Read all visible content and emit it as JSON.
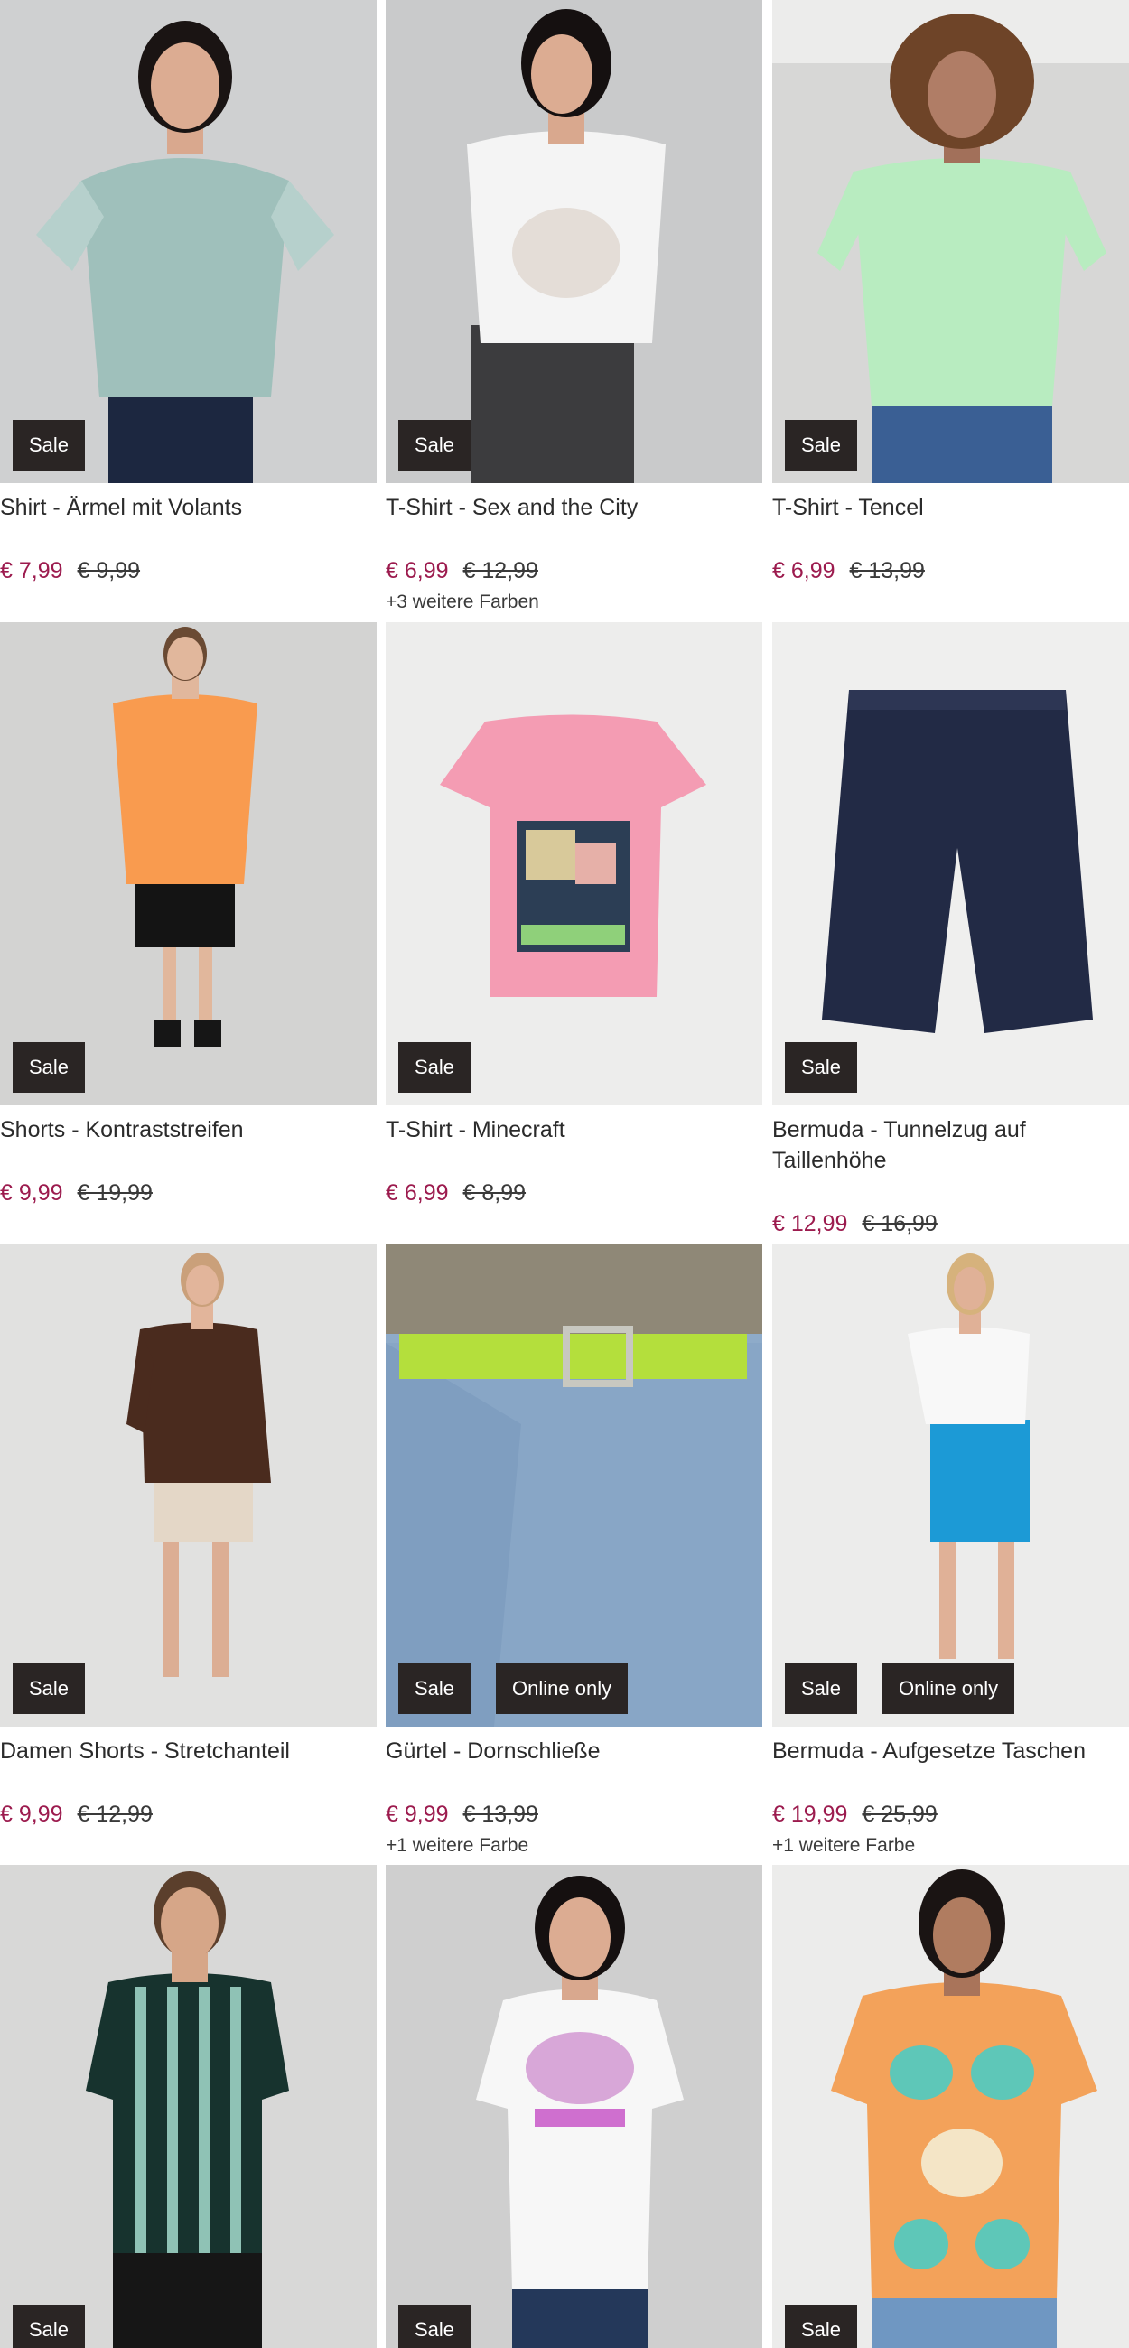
{
  "colors": {
    "sale_price": "#9c1b4e",
    "badge_bg": "#2a2524"
  },
  "products": [
    {
      "name": "Shirt - Ärmel mit Volants",
      "price": "€ 7,99",
      "old_price": "€ 9,99",
      "badges": [
        "Sale"
      ],
      "more_colors": "",
      "image": "woman-mint-top"
    },
    {
      "name": "T-Shirt - Sex and the City",
      "price": "€ 6,99",
      "old_price": "€ 12,99",
      "badges": [
        "Sale"
      ],
      "more_colors": "+3 weitere Farben",
      "image": "woman-white-print-tee"
    },
    {
      "name": "T-Shirt - Tencel",
      "price": "€ 6,99",
      "old_price": "€ 13,99",
      "badges": [
        "Sale"
      ],
      "more_colors": "",
      "image": "woman-green-tee"
    },
    {
      "name": "Shorts - Kontraststreifen",
      "price": "€ 9,99",
      "old_price": "€ 19,99",
      "badges": [
        "Sale"
      ],
      "more_colors": "",
      "image": "man-orange-tee"
    },
    {
      "name": "T-Shirt - Minecraft",
      "price": "€ 6,99",
      "old_price": "€ 8,99",
      "badges": [
        "Sale"
      ],
      "more_colors": "",
      "image": "pink-minecraft-tee"
    },
    {
      "name": "Bermuda - Tunnelzug auf Taillenhöhe",
      "price": "€ 12,99",
      "old_price": "€ 16,99",
      "badges": [
        "Sale"
      ],
      "more_colors": "",
      "image": "navy-bermuda"
    },
    {
      "name": "Damen Shorts - Stretchanteil",
      "price": "€ 9,99",
      "old_price": "€ 12,99",
      "badges": [
        "Sale"
      ],
      "more_colors": "",
      "image": "woman-beige-shorts"
    },
    {
      "name": "Gürtel - Dornschließe",
      "price": "€ 9,99",
      "old_price": "€ 13,99",
      "badges": [
        "Sale",
        "Online only"
      ],
      "more_colors": "+1 weitere Farbe",
      "image": "green-belt"
    },
    {
      "name": "Bermuda - Aufgesetze Taschen",
      "price": "€ 19,99",
      "old_price": "€ 25,99",
      "badges": [
        "Sale",
        "Online only"
      ],
      "more_colors": "+1 weitere Farbe",
      "image": "woman-blue-bermuda"
    },
    {
      "name": "",
      "price": "",
      "old_price": "",
      "badges": [
        "Sale"
      ],
      "more_colors": "",
      "image": "man-striped-tee"
    },
    {
      "name": "",
      "price": "",
      "old_price": "",
      "badges": [
        "Sale"
      ],
      "more_colors": "",
      "image": "woman-happiness-tee"
    },
    {
      "name": "",
      "price": "",
      "old_price": "",
      "badges": [
        "Sale"
      ],
      "more_colors": "",
      "image": "woman-paisley-tee"
    }
  ]
}
